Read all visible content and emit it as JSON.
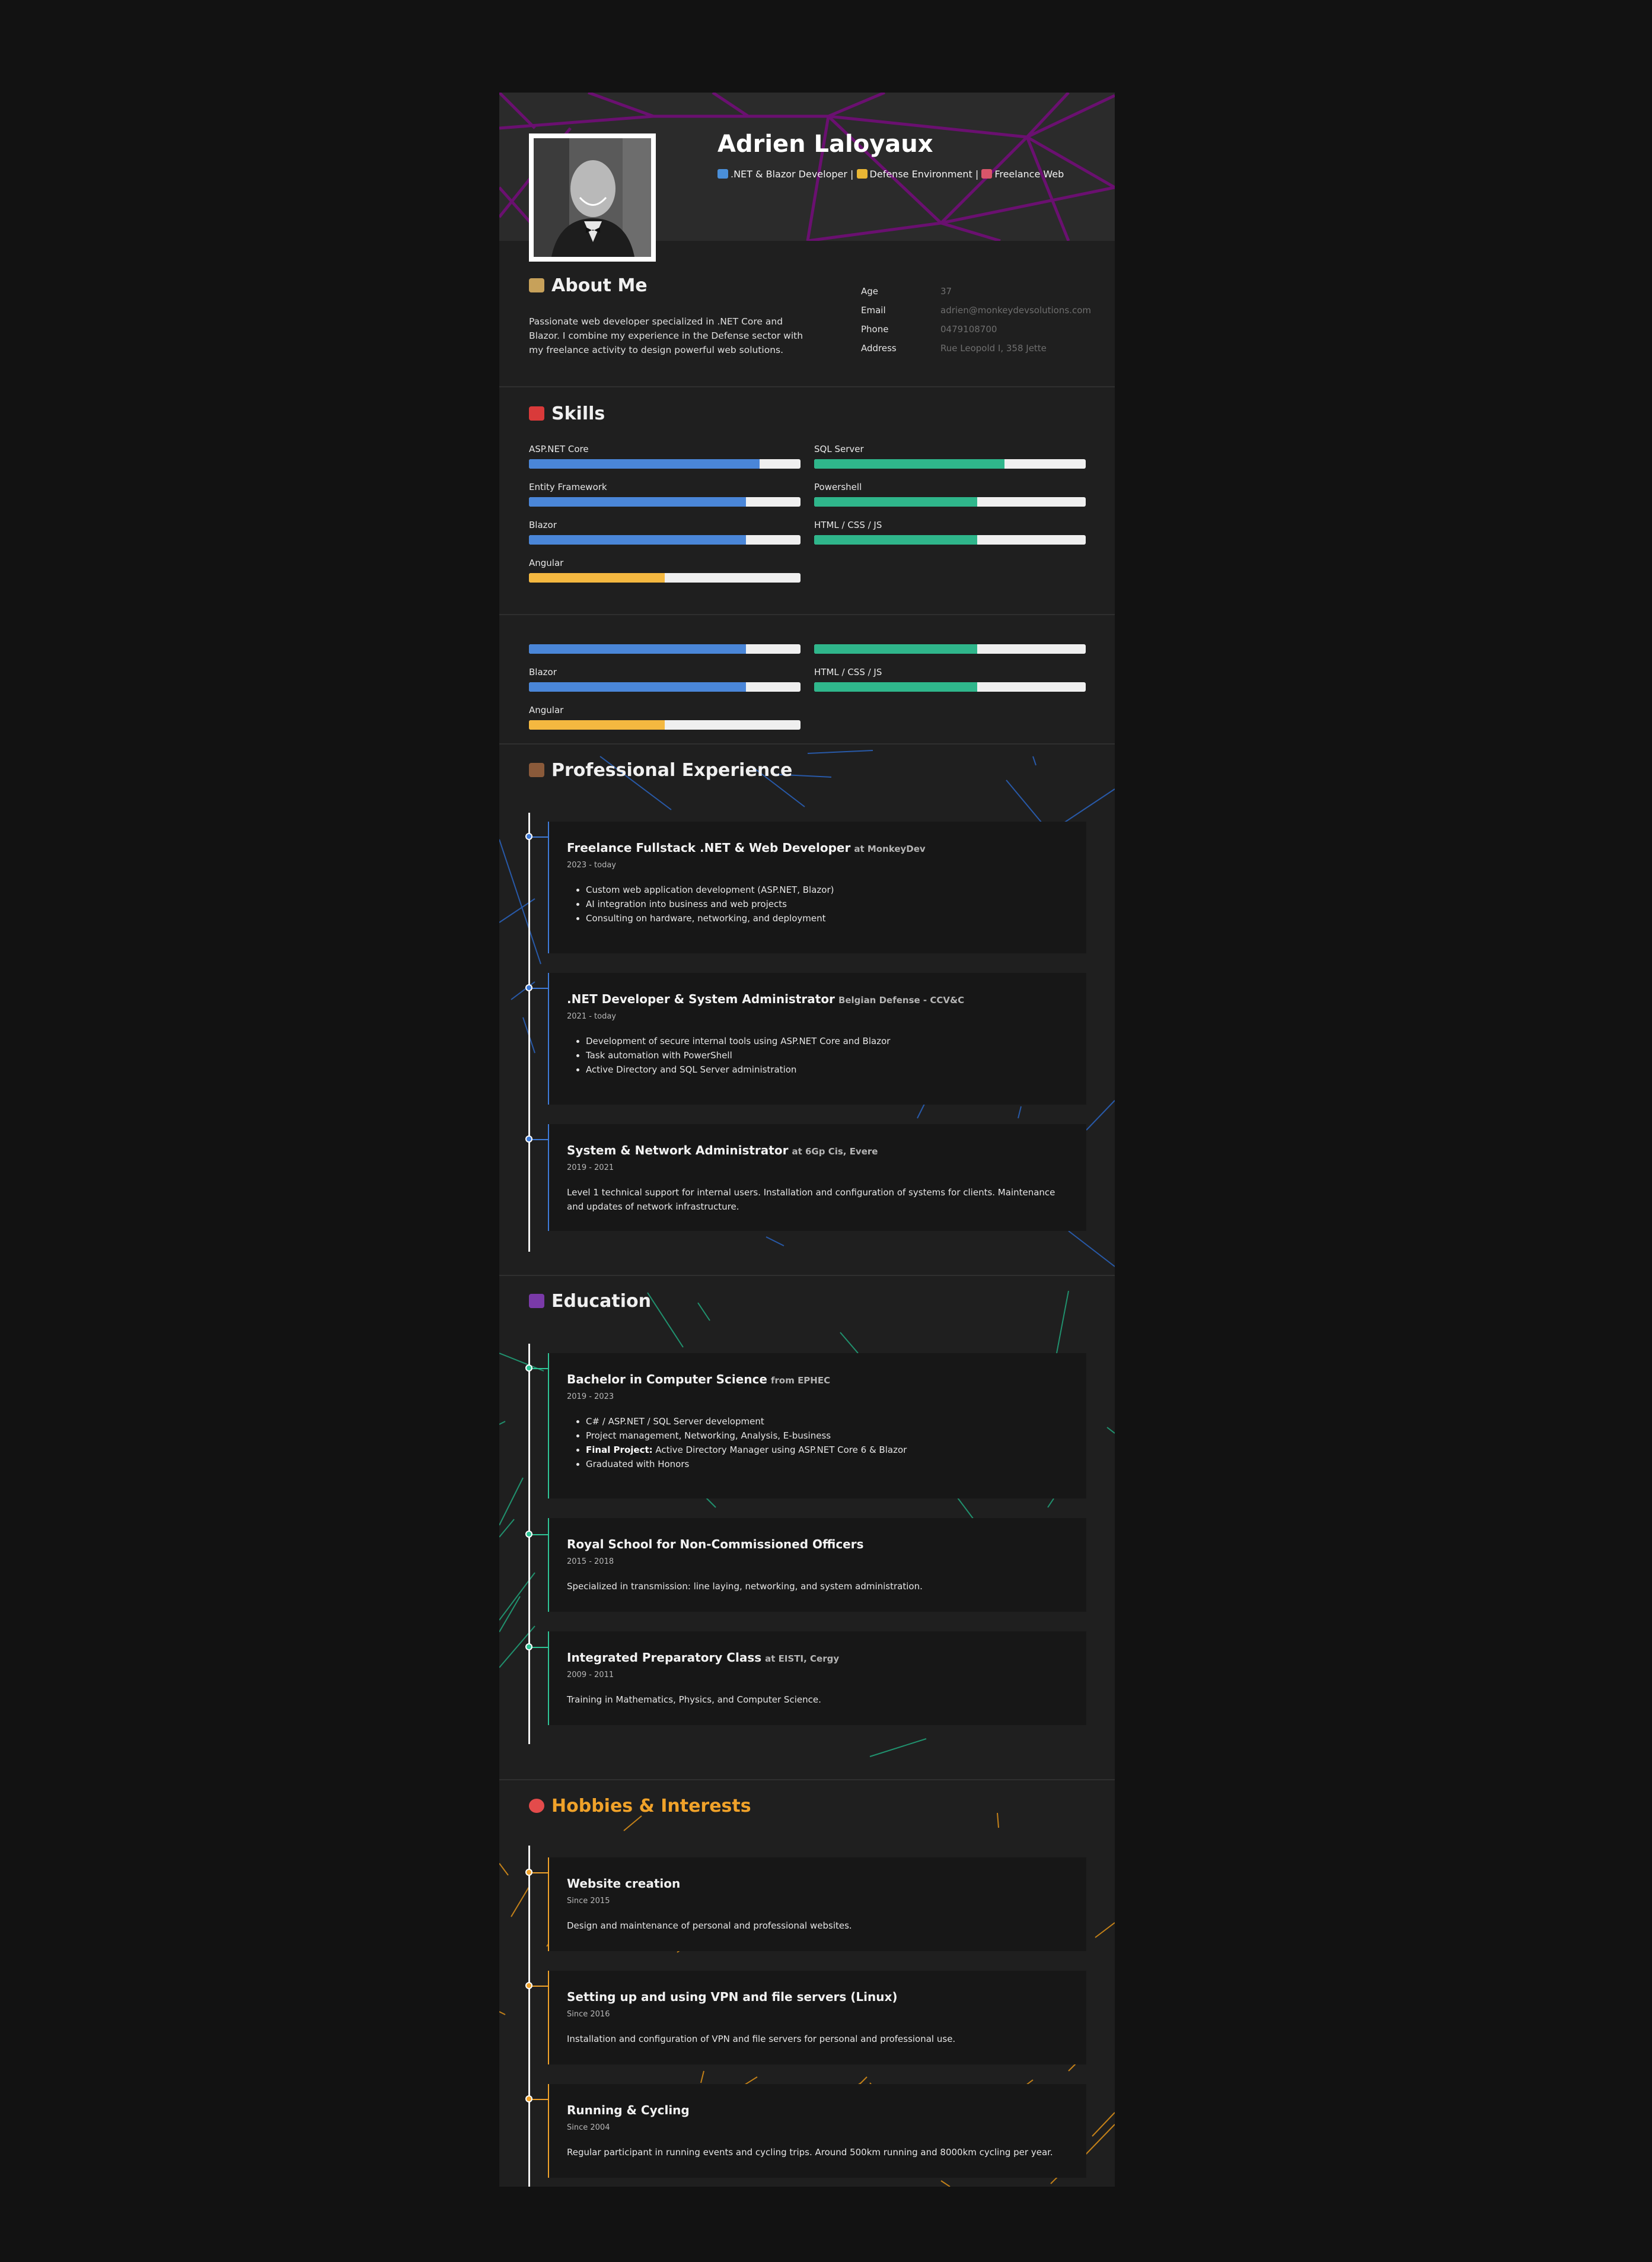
{
  "header": {
    "name": "Adrien Laloyaux",
    "tagline": {
      "part1": ".NET & Blazor Developer |",
      "part2": "Defense Environment |",
      "part3": "Freelance Web"
    }
  },
  "about": {
    "title": "About Me",
    "text": "Passionate web developer specialized in .NET Core and Blazor. I combine my experience in the Defense sector with my freelance activity to design powerful web solutions.",
    "info": [
      {
        "label": "Age",
        "value": "37"
      },
      {
        "label": "Email",
        "value": "adrien@monkeydevsolutions.com"
      },
      {
        "label": "Phone",
        "value": "0479108700"
      },
      {
        "label": "Address",
        "value": "Rue Leopold I, 358 Jette"
      }
    ]
  },
  "skills": {
    "title": "Skills",
    "left": [
      {
        "label": "ASP.NET Core",
        "level": 0.85,
        "color": "#4a86d8"
      },
      {
        "label": "Entity Framework",
        "level": 0.8,
        "color": "#4a86d8"
      },
      {
        "label": "Blazor",
        "level": 0.8,
        "color": "#4a86d8"
      },
      {
        "label": "Angular",
        "level": 0.5,
        "color": "#f4b840"
      }
    ],
    "right": [
      {
        "label": "SQL Server",
        "level": 0.7,
        "color": "#2fb68b"
      },
      {
        "label": "Powershell",
        "level": 0.6,
        "color": "#2fb68b"
      },
      {
        "label": "HTML / CSS / JS",
        "level": 0.6,
        "color": "#2fb68b"
      }
    ],
    "repeat_left": [
      {
        "label": "",
        "level": 0.8,
        "color": "#4a86d8"
      },
      {
        "label": "Blazor",
        "level": 0.8,
        "color": "#4a86d8"
      },
      {
        "label": "Angular",
        "level": 0.5,
        "color": "#f4b840"
      }
    ],
    "repeat_right": [
      {
        "label": "",
        "level": 0.6,
        "color": "#2fb68b"
      },
      {
        "label": "HTML / CSS / JS",
        "level": 0.6,
        "color": "#2fb68b"
      }
    ]
  },
  "experience": {
    "title": "Professional Experience",
    "accent": "#3f7bd8",
    "items": [
      {
        "title": "Freelance Fullstack .NET & Web Developer",
        "org": "at MonkeyDev",
        "date": "2023 - today",
        "bullets": [
          "Custom web application development (ASP.NET, Blazor)",
          "AI integration into business and web projects",
          "Consulting on hardware, networking, and deployment"
        ]
      },
      {
        "title": ".NET Developer & System Administrator",
        "org": "Belgian Defense - CCV&C",
        "date": "2021 - today",
        "bullets": [
          "Development of secure internal tools using ASP.NET Core and Blazor",
          "Task automation with PowerShell",
          "Active Directory and SQL Server administration"
        ]
      },
      {
        "title": "System & Network Administrator",
        "org": "at 6Gp Cis, Evere",
        "date": "2019 - 2021",
        "text": "Level 1 technical support for internal users. Installation and configuration of systems for clients. Maintenance and updates of network infrastructure."
      }
    ]
  },
  "education": {
    "title": "Education",
    "accent": "#2fc496",
    "items": [
      {
        "title": "Bachelor in Computer Science",
        "org": "from EPHEC",
        "date": "2019 - 2023",
        "bullets": [
          "C# / ASP.NET / SQL Server development",
          "Project management, Networking, Analysis, E-business"
        ],
        "bullet_bold_label": "Final Project:",
        "bullet_bold_text": " Active Directory Manager using ASP.NET Core 6 & Blazor",
        "bullet_last": "Graduated with Honors"
      },
      {
        "title": "Royal School for Non-Commissioned Officers",
        "org": "",
        "date": "2015 - 2018",
        "text": "Specialized in transmission: line laying, networking, and system administration."
      },
      {
        "title": "Integrated Preparatory Class",
        "org": "at EISTI, Cergy",
        "date": "2009 - 2011",
        "text": "Training in Mathematics, Physics, and Computer Science."
      }
    ]
  },
  "hobbies": {
    "title": "Hobbies & Interests",
    "accent": "#f0a22a",
    "items": [
      {
        "title": "Website creation",
        "date": "Since 2015",
        "text": "Design and maintenance of personal and professional websites."
      },
      {
        "title": "Setting up and using VPN and file servers (Linux)",
        "date": "Since 2016",
        "text": "Installation and configuration of VPN and file servers for personal and professional use."
      },
      {
        "title": "Running & Cycling",
        "date": "Since 2004",
        "text": "Regular participant in running events and cycling trips. Around 500km running and 8000km cycling per year."
      }
    ]
  }
}
